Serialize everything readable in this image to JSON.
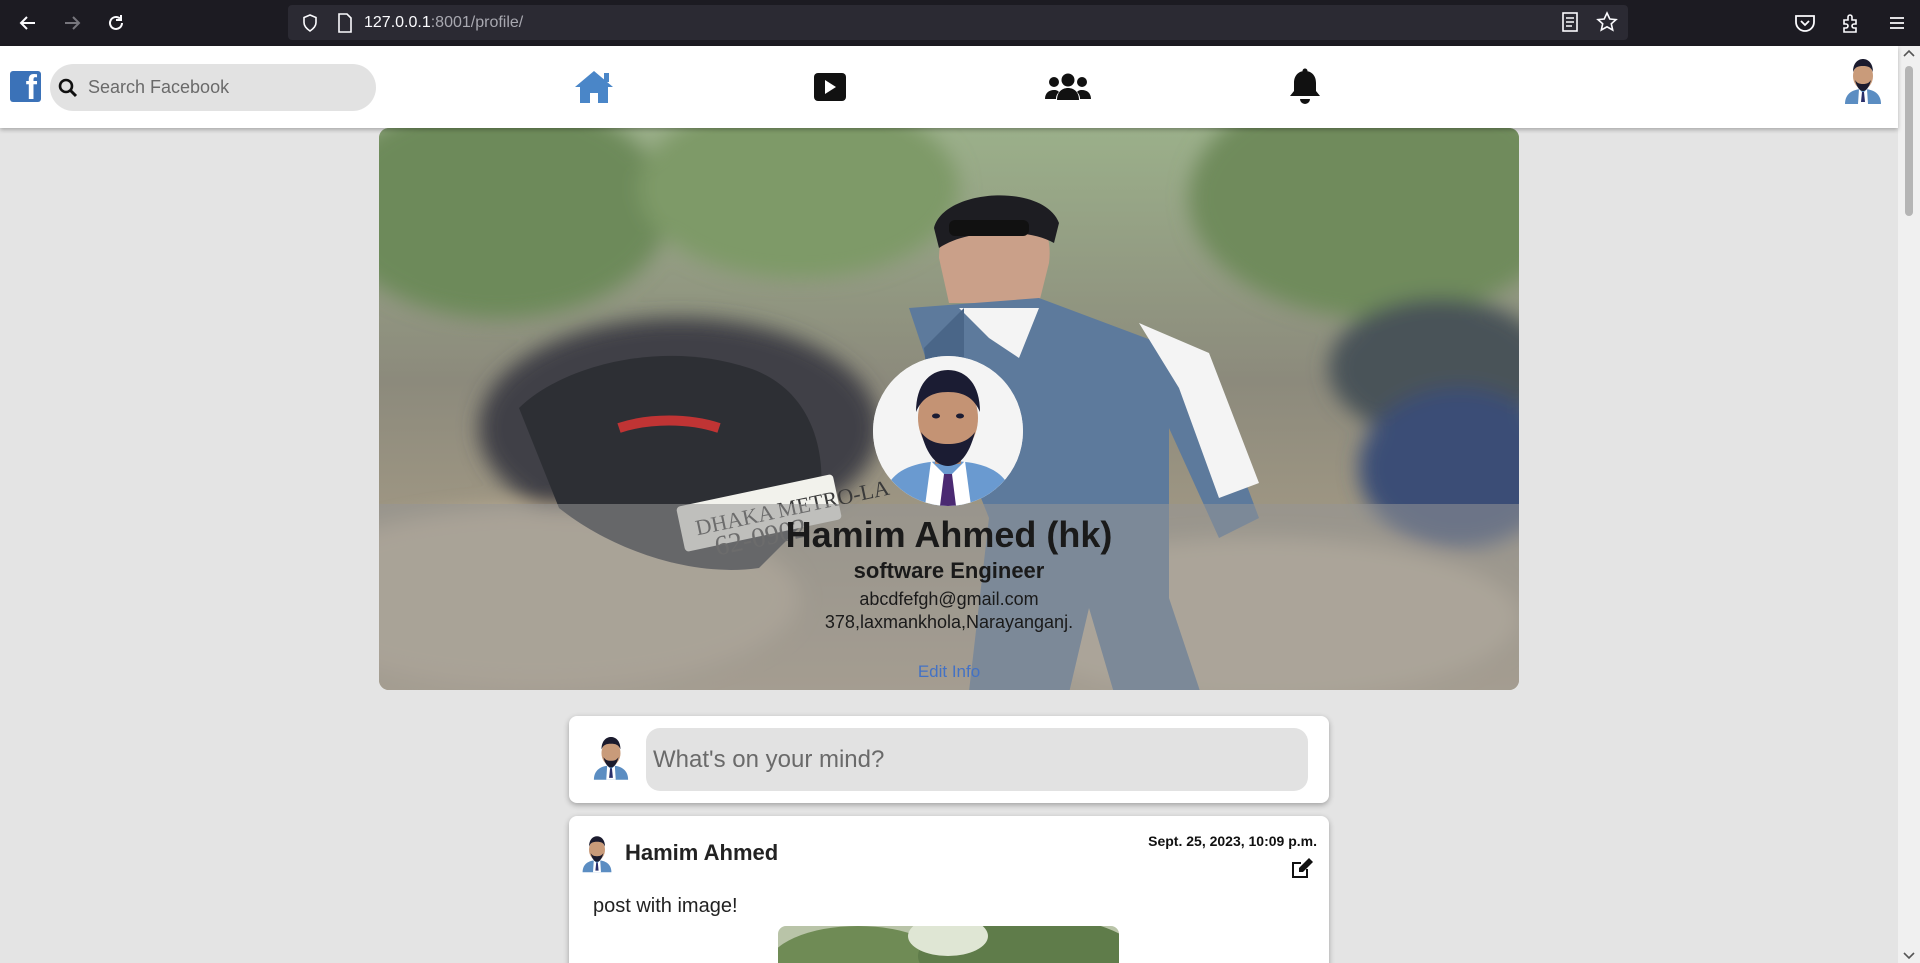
{
  "browser": {
    "url_host": "127.0.0.1",
    "url_rest": ":8001/profile/"
  },
  "header": {
    "search_placeholder": "Search Facebook",
    "logo_letter": "f",
    "nav_icons": [
      "home-icon",
      "video-icon",
      "groups-icon",
      "bell-icon"
    ],
    "accent_color": "#3b72b8"
  },
  "profile": {
    "name": "Hamim Ahmed (hk)",
    "title": "software Engineer",
    "email": "abcdfefgh@gmail.com",
    "address": "378,laxmankhola,Narayanganj.",
    "edit_label": "Edit Info"
  },
  "composer": {
    "placeholder": "What's on your mind?"
  },
  "posts": [
    {
      "author": "Hamim Ahmed",
      "date": "Sept. 25, 2023, 10:09 p.m.",
      "text": "post with image!"
    }
  ]
}
